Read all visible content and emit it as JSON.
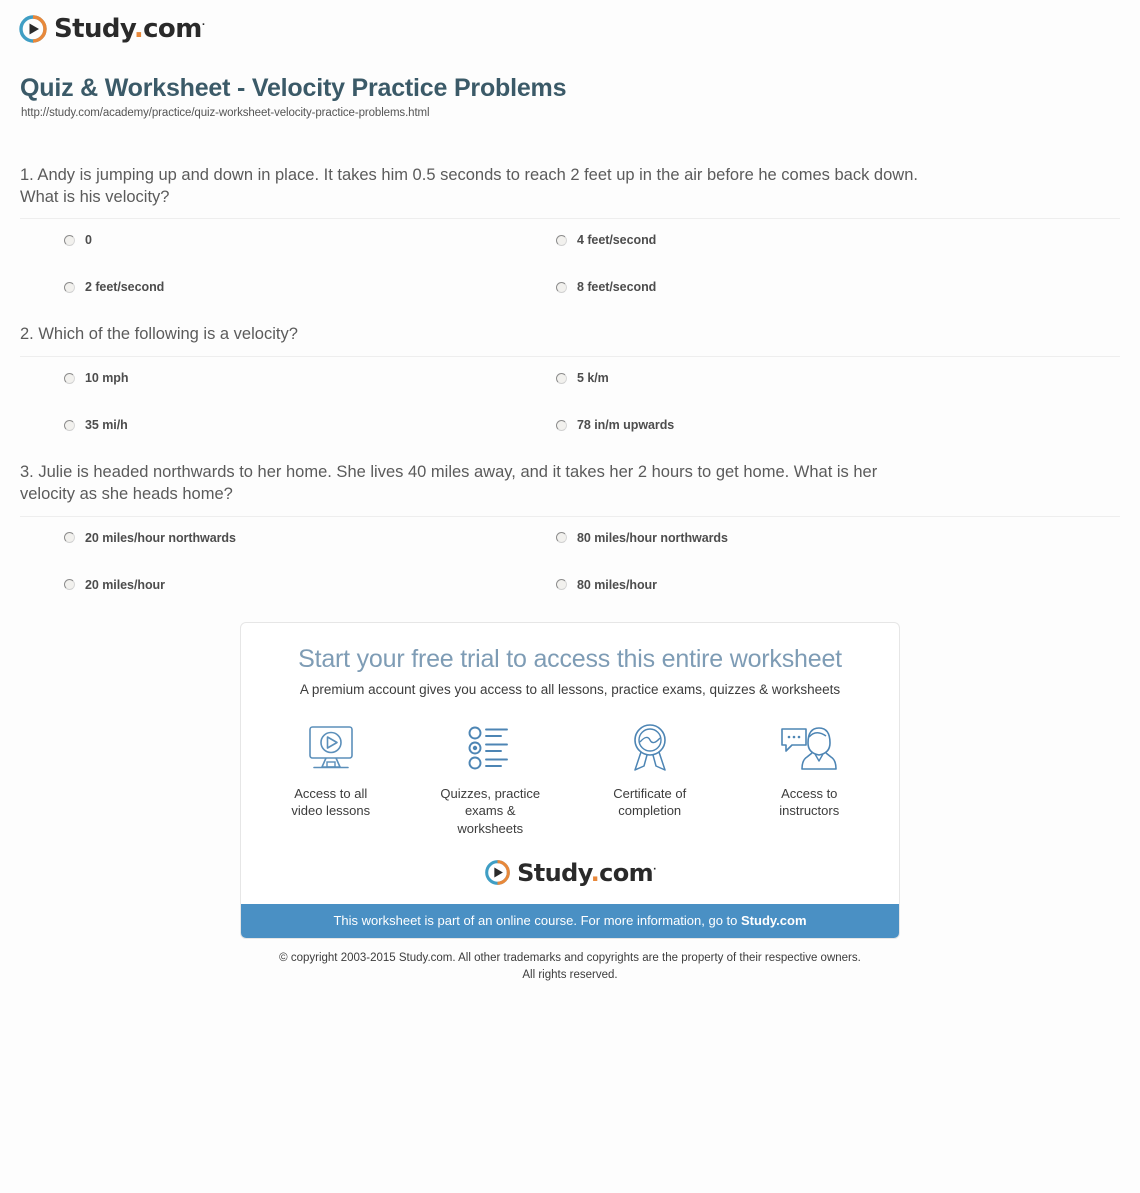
{
  "brand": {
    "name_main": "Study",
    "name_dot": ".",
    "name_tld": "com",
    "trademark": "·",
    "logo_blue": "#3f9ec4",
    "logo_orange": "#e8883a"
  },
  "header": {
    "title": "Quiz & Worksheet - Velocity Practice Problems",
    "url": "http://study.com/academy/practice/quiz-worksheet-velocity-practice-problems.html",
    "title_color": "#3b5a68"
  },
  "questions": [
    {
      "text": "1. Andy is jumping up and down in place. It takes him 0.5 seconds to reach 2 feet up in the air before he comes back down. What is his velocity?",
      "options": [
        "0",
        "4 feet/second",
        "2 feet/second",
        "8 feet/second"
      ]
    },
    {
      "text": "2. Which of the following is a velocity?",
      "options": [
        "10 mph",
        "5 k/m",
        "35 mi/h",
        "78 in/m upwards"
      ]
    },
    {
      "text": "3. Julie is headed northwards to her home. She lives 40 miles away, and it takes her 2 hours to get home. What is her velocity as she heads home?",
      "options": [
        "20 miles/hour northwards",
        "80 miles/hour northwards",
        "20 miles/hour",
        "80 miles/hour"
      ]
    }
  ],
  "promo": {
    "heading": "Start your free trial to access this entire worksheet",
    "subheading": "A premium account gives you access to all lessons, practice exams, quizzes & worksheets",
    "heading_color": "#7e9cb5",
    "features": [
      {
        "icon": "monitor-play-icon",
        "label": "Access to all\nvideo lessons"
      },
      {
        "icon": "checklist-icon",
        "label": "Quizzes, practice\nexams & worksheets"
      },
      {
        "icon": "award-ribbon-icon",
        "label": "Certificate of\ncompletion"
      },
      {
        "icon": "instructor-chat-icon",
        "label": "Access to\ninstructors"
      }
    ],
    "banner_text_prefix": "This worksheet is part of an online course. For more information, go to ",
    "banner_link_text": "Study.com",
    "banner_color": "#4a90c4"
  },
  "footer": {
    "copyright_line1": "© copyright 2003-2015 Study.com. All other trademarks and copyrights are the property of their respective owners.",
    "copyright_line2": "All rights reserved."
  }
}
